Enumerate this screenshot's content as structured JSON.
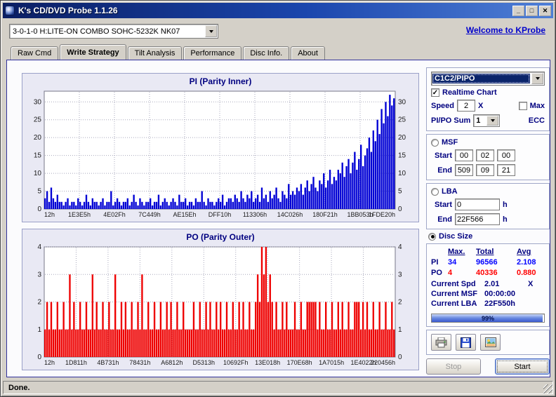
{
  "window": {
    "title": "K's CD/DVD Probe 1.1.26"
  },
  "icons": {
    "minimize": "_",
    "maximize": "□",
    "close": "✕",
    "check": "✓",
    "dropdown": "▼"
  },
  "colors": {
    "navy": "#000080",
    "pi_color": "#0000d4",
    "po_color": "#ee0000",
    "link": "#0000cc",
    "titlebar_left": "#0a1e63",
    "titlebar_right": "#4f7fd6"
  },
  "toolbar": {
    "drive_selector": "3-0-1-0 H:LITE-ON COMBO SOHC-5232K NK07",
    "welcome_link": "Welcome to KProbe"
  },
  "tabs": [
    {
      "label": "Raw Cmd",
      "active": false
    },
    {
      "label": "Write Strategy",
      "active": true
    },
    {
      "label": "Tilt Analysis",
      "active": false
    },
    {
      "label": "Performance",
      "active": false
    },
    {
      "label": "Disc Info.",
      "active": false
    },
    {
      "label": "About",
      "active": false
    }
  ],
  "controls": {
    "mode_selector": "C1C2/PIPO",
    "realtime_chart": {
      "label": "Realtime Chart",
      "checked": true
    },
    "speed": {
      "label": "Speed",
      "value": "2",
      "unit": "X",
      "max_label": "Max",
      "max_checked": false
    },
    "pipo_sum": {
      "label": "PI/PO Sum",
      "value": "1",
      "unit": "ECC"
    },
    "msf": {
      "label": "MSF",
      "selected": false,
      "start_label": "Start",
      "end_label": "End",
      "start": [
        "00",
        "02",
        "00"
      ],
      "end": [
        "509",
        "09",
        "21"
      ]
    },
    "lba": {
      "label": "LBA",
      "selected": false,
      "start_label": "Start",
      "end_label": "End",
      "start": "0",
      "end": "22F566",
      "unit": "h"
    },
    "disc_size": {
      "label": "Disc Size",
      "selected": true
    }
  },
  "stats": {
    "headers": [
      "Max.",
      "Total",
      "Avg"
    ],
    "rows": [
      {
        "label": "PI",
        "max": "34",
        "total": "96566",
        "avg": "2.108"
      },
      {
        "label": "PO",
        "max": "4",
        "total": "40336",
        "avg": "0.880"
      }
    ],
    "current": [
      {
        "label": "Current Spd",
        "value": "2.01",
        "unit": "X"
      },
      {
        "label": "Current MSF",
        "value": "00:00:00"
      },
      {
        "label": "Current LBA",
        "value": "22F550h"
      }
    ],
    "progress": {
      "percent": 99,
      "label": "99%"
    }
  },
  "actions": {
    "stop": "Stop",
    "start": "Start"
  },
  "statusbar": {
    "text": "Done."
  },
  "chart_data": [
    {
      "type": "bar",
      "title": "PI (Parity Inner)",
      "color": "#0000d4",
      "ylim": [
        0,
        33
      ],
      "yticks": [
        0,
        5,
        10,
        15,
        20,
        25,
        30
      ],
      "xticklabels": [
        "12h",
        "1E3E5h",
        "4E02Fh",
        "7C449h",
        "AE15Eh",
        "DFF10h",
        "113306h",
        "14C026h",
        "180F21h",
        "1BB053h",
        "1FDE20h"
      ],
      "values": [
        3,
        5,
        2,
        6,
        3,
        2,
        4,
        2,
        2,
        1,
        2,
        3,
        1,
        2,
        2,
        1,
        3,
        2,
        1,
        2,
        4,
        2,
        1,
        3,
        2,
        2,
        1,
        2,
        3,
        1,
        2,
        2,
        5,
        1,
        2,
        3,
        2,
        1,
        2,
        2,
        3,
        1,
        2,
        4,
        2,
        1,
        3,
        2,
        1,
        2,
        2,
        3,
        1,
        2,
        2,
        4,
        1,
        2,
        3,
        2,
        1,
        2,
        3,
        2,
        1,
        4,
        2,
        2,
        3,
        1,
        2,
        2,
        1,
        3,
        2,
        2,
        5,
        2,
        1,
        3,
        2,
        2,
        1,
        2,
        3,
        2,
        4,
        1,
        2,
        3,
        3,
        2,
        4,
        3,
        2,
        5,
        3,
        2,
        4,
        3,
        5,
        2,
        3,
        4,
        2,
        6,
        3,
        4,
        2,
        5,
        3,
        4,
        6,
        3,
        2,
        5,
        4,
        3,
        7,
        4,
        5,
        4,
        6,
        5,
        7,
        4,
        6,
        8,
        5,
        7,
        9,
        6,
        5,
        8,
        7,
        10,
        6,
        8,
        11,
        7,
        9,
        8,
        11,
        10,
        13,
        9,
        12,
        14,
        10,
        13,
        16,
        11,
        14,
        18,
        12,
        15,
        17,
        20,
        16,
        22,
        19,
        25,
        21,
        28,
        24,
        30,
        26,
        32,
        29,
        31
      ]
    },
    {
      "type": "bar",
      "title": "PO (Parity Outer)",
      "color": "#ee0000",
      "ylim": [
        0,
        4
      ],
      "yticks": [
        0,
        1,
        2,
        3,
        4
      ],
      "xticklabels": [
        "12h",
        "1D811h",
        "4B731h",
        "78431h",
        "A6812h",
        "D5313h",
        "10692Fh",
        "13E018h",
        "170E68h",
        "1A7015h",
        "1E4022h",
        "220456h"
      ],
      "values": [
        1,
        2,
        1,
        2,
        1,
        1,
        2,
        1,
        1,
        2,
        1,
        1,
        3,
        1,
        2,
        1,
        1,
        2,
        1,
        1,
        2,
        1,
        1,
        3,
        1,
        2,
        1,
        1,
        2,
        1,
        1,
        2,
        1,
        1,
        3,
        1,
        1,
        2,
        1,
        2,
        1,
        1,
        2,
        1,
        1,
        2,
        1,
        3,
        1,
        1,
        2,
        1,
        1,
        2,
        1,
        1,
        2,
        1,
        1,
        2,
        1,
        2,
        1,
        1,
        2,
        1,
        1,
        2,
        1,
        1,
        1,
        1,
        2,
        1,
        1,
        2,
        1,
        1,
        2,
        1,
        2,
        1,
        1,
        2,
        1,
        2,
        1,
        1,
        2,
        1,
        1,
        2,
        1,
        1,
        2,
        1,
        2,
        1,
        1,
        2,
        1,
        1,
        2,
        3,
        2,
        4,
        3,
        4,
        2,
        3,
        2,
        1,
        2,
        1,
        1,
        2,
        1,
        2,
        1,
        1,
        1,
        2,
        1,
        1,
        2,
        1,
        1,
        2,
        2,
        2,
        2,
        2,
        1,
        2,
        1,
        1,
        2,
        1,
        1,
        2,
        1,
        1,
        2,
        1,
        2,
        1,
        1,
        2,
        1,
        1,
        2,
        2,
        2,
        1,
        2,
        1,
        2,
        1,
        1,
        2,
        1,
        1,
        2,
        1,
        1,
        2,
        1,
        1,
        2,
        1
      ]
    }
  ]
}
